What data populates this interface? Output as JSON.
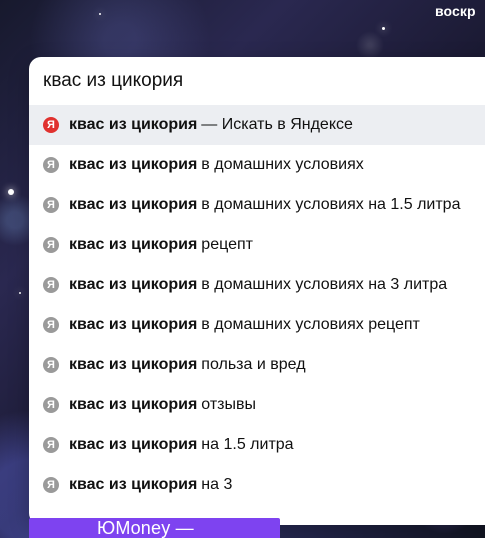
{
  "header": {
    "right_link": "воскр"
  },
  "search": {
    "query": "квас из цикория",
    "icon_text": "Я",
    "icon_colors": {
      "primary": "#e0312f",
      "secondary": "#9a9a9a"
    },
    "suggestions": [
      {
        "bold": "квас из цикория",
        "rest": "— Искать в Яндексе"
      },
      {
        "bold": "квас из цикория",
        "rest": "в домашних условиях"
      },
      {
        "bold": "квас из цикория",
        "rest": "в домашних условиях на 1.5 литра"
      },
      {
        "bold": "квас из цикория",
        "rest": "рецепт"
      },
      {
        "bold": "квас из цикория",
        "rest": "в домашних условиях на 3 литра"
      },
      {
        "bold": "квас из цикория",
        "rest": "в домашних условиях рецепт"
      },
      {
        "bold": "квас из цикория",
        "rest": "польза и вред"
      },
      {
        "bold": "квас из цикория",
        "rest": "отзывы"
      },
      {
        "bold": "квас из цикория",
        "rest": "на 1.5 литра"
      },
      {
        "bold": "квас из цикория",
        "rest": "на 3"
      }
    ]
  },
  "promo": {
    "text": "ЮMoney —"
  },
  "colors": {
    "search_background": "#ffffff",
    "active_row": "#eceef2",
    "promo_background": "#7e43f0"
  }
}
